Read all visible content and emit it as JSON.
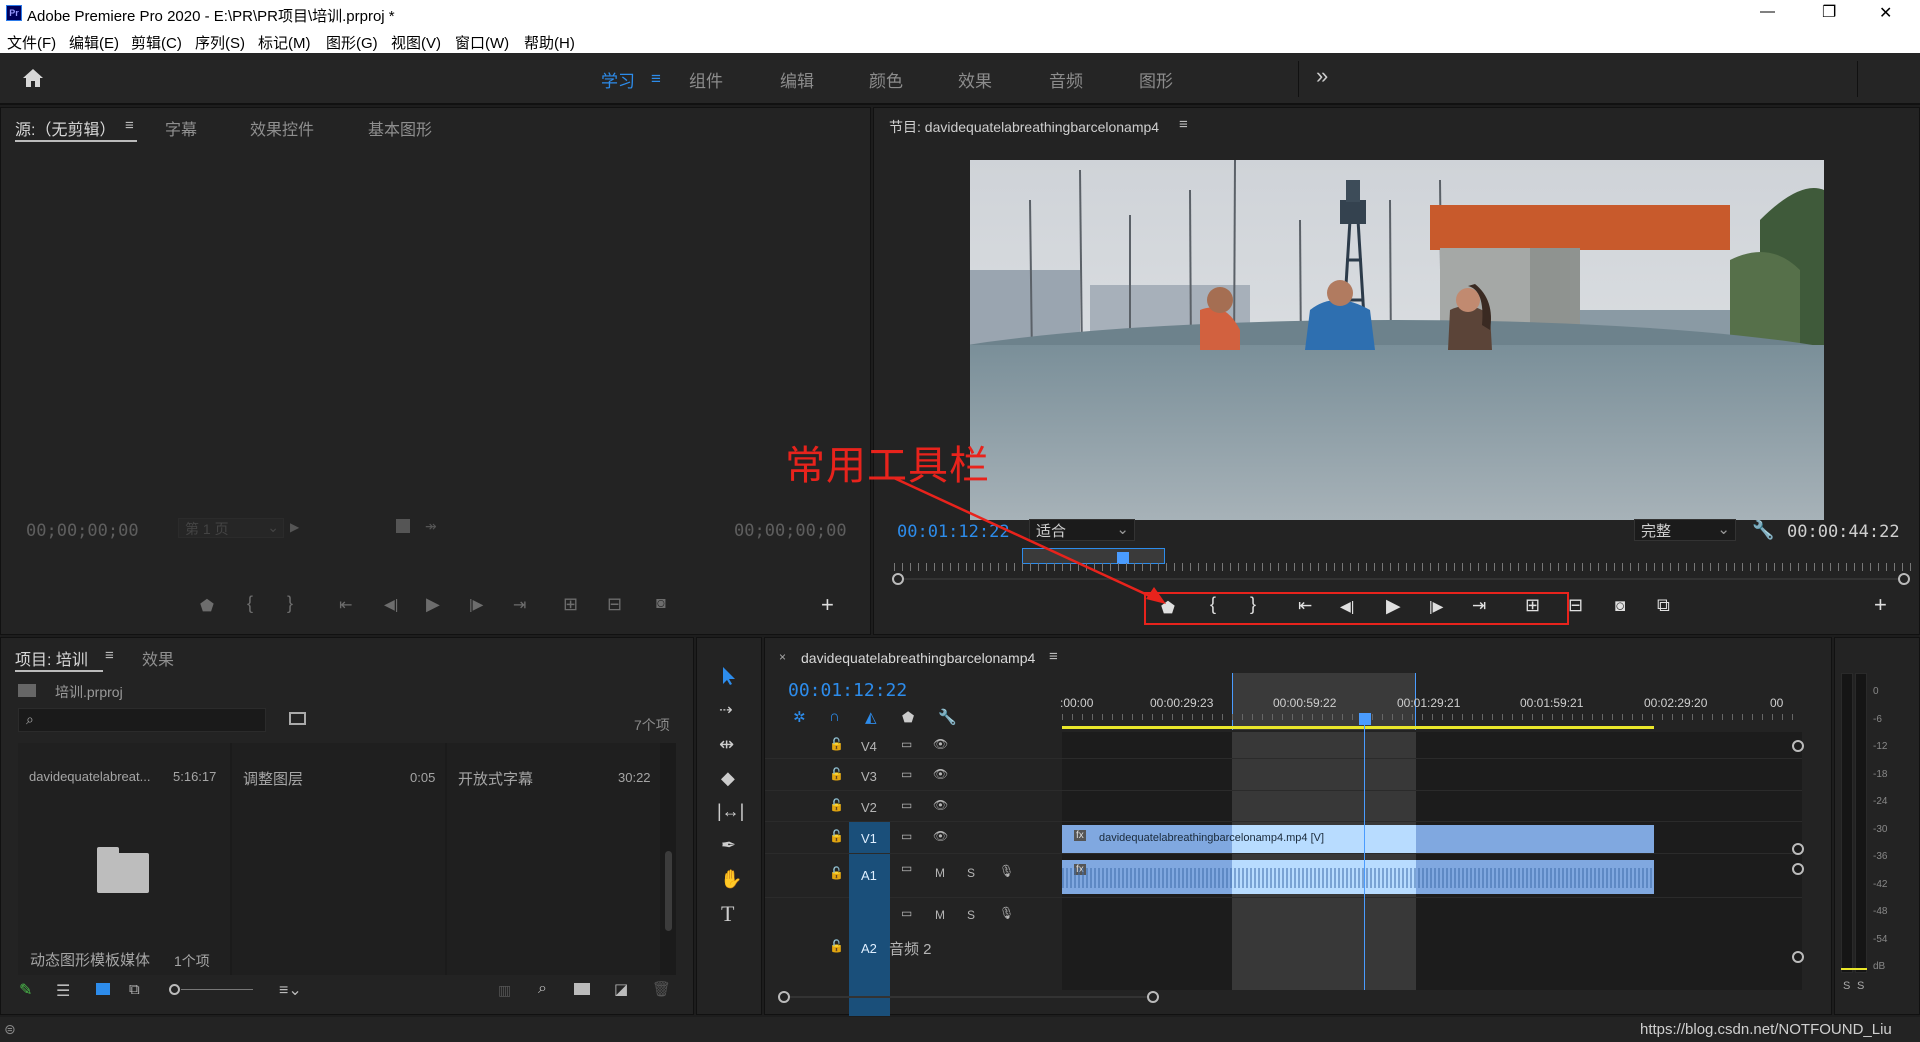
{
  "window": {
    "title": "Adobe Premiere Pro 2020 - E:\\PR\\PR项目\\培训.prproj *",
    "app_icon": "Pr",
    "minimize": "—",
    "maximize": "❐",
    "close": "✕"
  },
  "menu": [
    "文件(F)",
    "编辑(E)",
    "剪辑(C)",
    "序列(S)",
    "标记(M)",
    "图形(G)",
    "视图(V)",
    "窗口(W)",
    "帮助(H)"
  ],
  "workspace": {
    "tabs": [
      "学习",
      "组件",
      "编辑",
      "颜色",
      "效果",
      "音频",
      "图形"
    ],
    "active": "学习",
    "more": "»"
  },
  "source": {
    "tabs": [
      "源:（无剪辑）",
      "字幕",
      "效果控件",
      "基本图形"
    ],
    "timecode_in": "00;00;00;00",
    "timecode_out": "00;00;00;00",
    "page_label": "第 1 页"
  },
  "program": {
    "title": "节目: davidequatelabreathingbarcelonamp4",
    "timecode": "00:01:12:22",
    "fit": "适合",
    "quality": "完整",
    "duration": "00:00:44:22"
  },
  "annotation": {
    "text": "常用工具栏",
    "color": "#e8231c"
  },
  "project": {
    "tabs": [
      "项目: 培训",
      "效果"
    ],
    "file": "培训.prproj",
    "count": "7个项",
    "items": [
      {
        "name": "davidequatelabreat...",
        "duration": "5:16:17"
      },
      {
        "name": "调整图层",
        "duration": "0:05"
      },
      {
        "name": "开放式字幕",
        "duration": "30:22"
      }
    ],
    "bin": {
      "name": "动态图形模板媒体",
      "count": "1个项"
    }
  },
  "timeline": {
    "sequence": "davidequatelabreathingbarcelonamp4",
    "timecode": "00:01:12:22",
    "ruler": [
      ":00:00",
      "00:00:29:23",
      "00:00:59:22",
      "00:01:29:21",
      "00:01:59:21",
      "00:02:29:20",
      "00"
    ],
    "video_tracks": [
      "V4",
      "V3",
      "V2",
      "V1"
    ],
    "audio_tracks": [
      "A1",
      "A2"
    ],
    "audio2_name": "音频 2",
    "clip_label": "davidequatelabreathingbarcelonamp4.mp4 [V]",
    "fx": "fx",
    "m": "M",
    "s": "S"
  },
  "meter": {
    "scale": [
      "0",
      "-6",
      "-12",
      "-18",
      "-24",
      "-30",
      "-36",
      "-42",
      "-48",
      "-54",
      "dB"
    ],
    "solo": [
      "S",
      "S"
    ]
  },
  "watermark": "https://blog.csdn.net/NOTFOUND_Liu",
  "colors": {
    "accent": "#2d8ceb",
    "annotation": "#e8231c",
    "playhead": "#4a9cff",
    "workarea": "#e9e62a",
    "clip_video": "#80a8e0",
    "clip_highlight": "#b8dcff"
  }
}
